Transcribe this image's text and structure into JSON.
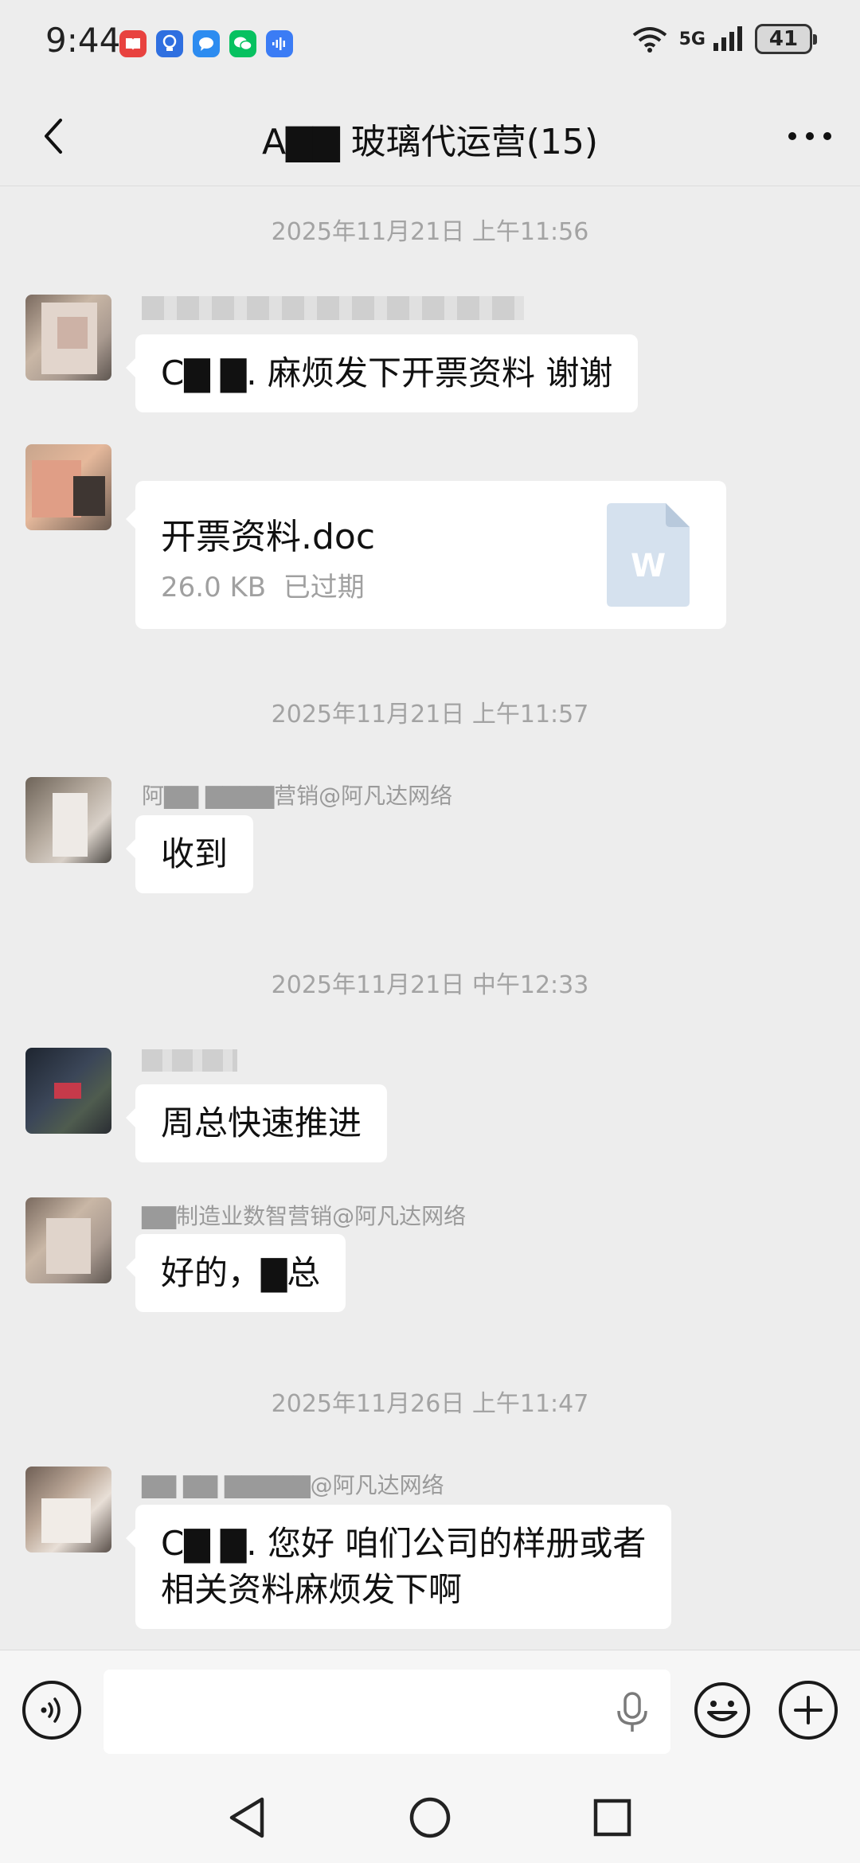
{
  "status_bar": {
    "time": "9:44",
    "network": "5G",
    "battery": "41"
  },
  "header": {
    "title": "A▇▇ 玻璃代运营(15)"
  },
  "messages": [
    {
      "time": "2025年11月21日 上午11:56"
    },
    {
      "text": "C▇ ▇. 麻烦发下开票资料 谢谢"
    },
    {
      "file_name": "开票资料.doc",
      "file_size": "26.0 KB",
      "file_status": "已过期",
      "file_badge": "W"
    },
    {
      "time": "2025年11月21日 上午11:57"
    },
    {
      "sender": "阿▇▇ ▇▇▇▇营销@阿凡达网络",
      "text": "收到"
    },
    {
      "time": "2025年11月21日 中午12:33"
    },
    {
      "text": "周总快速推进"
    },
    {
      "sender": "▇▇制造业数智营销@阿凡达网络",
      "text": "好的，▇总"
    },
    {
      "time": "2025年11月26日 上午11:47"
    },
    {
      "sender": "▇▇ ▇▇ ▇▇▇▇▇@阿凡达网络",
      "text_line1": "C▇ ▇. 您好 咱们公司的样册或者",
      "text_line2": "相关资料麻烦发下啊"
    }
  ],
  "input": {
    "placeholder": "",
    "value": ""
  },
  "icons": {
    "back": "chevron-left-icon",
    "more": "more-dots-icon",
    "voice": "voice-wave-icon",
    "mic": "microphone-icon",
    "emoji": "emoji-icon",
    "plus": "plus-icon",
    "nav_back": "triangle-back-icon",
    "nav_home": "circle-home-icon",
    "nav_recent": "square-recent-icon"
  },
  "colors": {
    "background": "#ededed",
    "bubble": "#ffffff",
    "timestamp": "#a3a3a3",
    "file_icon": "#d5e1ee"
  }
}
